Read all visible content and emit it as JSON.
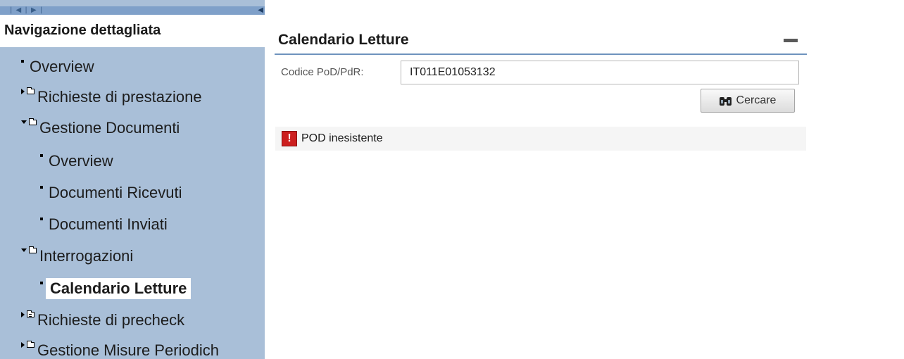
{
  "sidebar": {
    "title": "Navigazione dettagliata",
    "topbar_nav_glyph": "| ◀ | ▶ |",
    "topbar_collapse_glyph": "◀",
    "items": [
      {
        "label": "Overview",
        "type": "leaf"
      },
      {
        "label": "Richieste di prestazione",
        "type": "folder-collapsed"
      },
      {
        "label": "Gestione Documenti",
        "type": "folder-expanded"
      },
      {
        "label": "Overview",
        "type": "leaf"
      },
      {
        "label": "Documenti Ricevuti",
        "type": "leaf"
      },
      {
        "label": "Documenti Inviati",
        "type": "leaf"
      },
      {
        "label": "Interrogazioni",
        "type": "folder-expanded"
      },
      {
        "label": "Calendario Letture",
        "type": "leaf",
        "active": true
      },
      {
        "label": "Richieste di precheck",
        "type": "folder-collapsed"
      },
      {
        "label": "Gestione Misure Periodich",
        "type": "folder-collapsed"
      }
    ]
  },
  "panel": {
    "title": "Calendario Letture",
    "minimize_icon": "minimize-icon",
    "pod_label": "Codice PoD/PdR:",
    "pod_value": "IT011E01053132",
    "search_label": "Cercare",
    "search_icon": "binoculars-icon"
  },
  "message": {
    "icon": "error-icon",
    "icon_glyph": "!",
    "text": "POD inesistente"
  },
  "colors": {
    "sidebar_bg": "#a9bfd8",
    "accent_rule": "#6e93bd",
    "error": "#cc1f1f"
  }
}
